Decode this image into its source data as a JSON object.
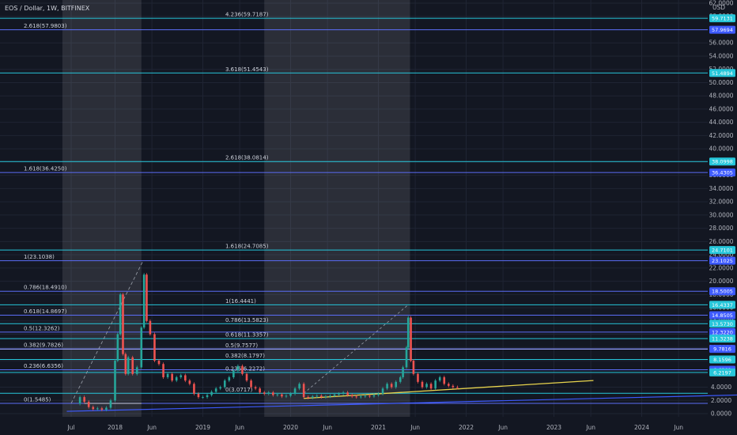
{
  "header": {
    "title": "EOS / Dollar, 1W, BITFINEX",
    "currency": "USD"
  },
  "chart_data": {
    "type": "line",
    "title": "EOS / Dollar, 1W, BITFINEX",
    "x_ticks": [
      "Jul",
      "2018",
      "Jun",
      "2019",
      "Jun",
      "2020",
      "Jun",
      "2021",
      "Jun",
      "2022",
      "Jun",
      "2023",
      "Jun",
      "2024",
      "Jun"
    ],
    "y_ticks": [
      "0.0000",
      "2.0000",
      "4.0000",
      "6.0000",
      "8.0000",
      "10.0000",
      "12.0000",
      "14.0000",
      "16.0000",
      "18.0000",
      "20.0000",
      "22.0000",
      "24.0000",
      "26.0000",
      "28.0000",
      "30.0000",
      "32.0000",
      "34.0000",
      "36.0000",
      "38.0000",
      "40.0000",
      "42.0000",
      "44.0000",
      "46.0000",
      "48.0000",
      "50.0000",
      "52.0000",
      "54.0000",
      "56.0000",
      "58.0000",
      "60.0000",
      "62.0000"
    ],
    "ylim": [
      0,
      62
    ],
    "fib_levels": [
      {
        "label": "4.236(59.7187)",
        "value": 59.7187,
        "color": "#26c6da",
        "anchor": "mid"
      },
      {
        "label": "2.618(57.9803)",
        "value": 57.9803,
        "color": "#5b6df6",
        "anchor": "left"
      },
      {
        "label": "3.618(51.4543)",
        "value": 51.4543,
        "color": "#26c6da",
        "anchor": "mid"
      },
      {
        "label": "2.618(38.0814)",
        "value": 38.0814,
        "color": "#26c6da",
        "anchor": "mid"
      },
      {
        "label": "1.618(36.4250)",
        "value": 36.425,
        "color": "#5b6df6",
        "anchor": "left"
      },
      {
        "label": "1.618(24.7085)",
        "value": 24.7085,
        "color": "#26c6da",
        "anchor": "mid"
      },
      {
        "label": "1(23.1038)",
        "value": 23.1038,
        "color": "#5b6df6",
        "anchor": "left"
      },
      {
        "label": "0.786(18.4910)",
        "value": 18.491,
        "color": "#5b6df6",
        "anchor": "left"
      },
      {
        "label": "1(16.4441)",
        "value": 16.4441,
        "color": "#26c6da",
        "anchor": "mid"
      },
      {
        "label": "0.618(14.8697)",
        "value": 14.8697,
        "color": "#5b6df6",
        "anchor": "left"
      },
      {
        "label": "0.786(13.5823)",
        "value": 13.5823,
        "color": "#26c6da",
        "anchor": "mid"
      },
      {
        "label": "0.5(12.3262)",
        "value": 12.3262,
        "color": "#5b6df6",
        "anchor": "left"
      },
      {
        "label": "0.618(11.3357)",
        "value": 11.3357,
        "color": "#26c6da",
        "anchor": "mid"
      },
      {
        "label": "0.382(9.7826)",
        "value": 9.7826,
        "color": "#5b6df6",
        "anchor": "left"
      },
      {
        "label": "0.5(9.7577)",
        "value": 9.7577,
        "color": "#9fa8ff",
        "anchor": "mid"
      },
      {
        "label": "0.382(8.1797)",
        "value": 8.1797,
        "color": "#26c6da",
        "anchor": "mid"
      },
      {
        "label": "0.236(6.6356)",
        "value": 6.6356,
        "color": "#5b6df6",
        "anchor": "left"
      },
      {
        "label": "0.236(6.2272)",
        "value": 6.2272,
        "color": "#26c6da",
        "anchor": "mid"
      },
      {
        "label": "0(1.5485)",
        "value": 1.5485,
        "color": "#5b6df6",
        "anchor": "left"
      },
      {
        "label": "0(3.0717)",
        "value": 3.0717,
        "color": "#26c6da",
        "anchor": "mid"
      }
    ],
    "price_badges": [
      {
        "text": "59.7131",
        "value": 59.7187,
        "color": "#26c6da"
      },
      {
        "text": "57.9694",
        "value": 57.9803,
        "color": "#3d5afe"
      },
      {
        "text": "51.4894",
        "value": 51.4543,
        "color": "#26c6da"
      },
      {
        "text": "38.0998",
        "value": 38.0814,
        "color": "#26c6da"
      },
      {
        "text": "36.4305",
        "value": 36.425,
        "color": "#3d5afe"
      },
      {
        "text": "24.7101",
        "value": 24.7085,
        "color": "#26c6da"
      },
      {
        "text": "23.1025",
        "value": 23.1038,
        "color": "#3d5afe"
      },
      {
        "text": "18.5005",
        "value": 18.491,
        "color": "#3d5afe"
      },
      {
        "text": "16.4337",
        "value": 16.4441,
        "color": "#26c6da"
      },
      {
        "text": "14.8505",
        "value": 14.8697,
        "color": "#3d5afe"
      },
      {
        "text": "13.5730",
        "value": 13.5823,
        "color": "#26c6da"
      },
      {
        "text": "12.3220",
        "value": 12.3262,
        "color": "#3d5afe"
      },
      {
        "text": "11.3238",
        "value": 11.3357,
        "color": "#26c6da"
      },
      {
        "text": "9.7816",
        "value": 9.7826,
        "color": "#3d5afe"
      },
      {
        "text": "8.1596",
        "value": 8.1797,
        "color": "#26c6da"
      },
      {
        "text": "6.6301",
        "value": 6.6356,
        "color": "#3d5afe"
      },
      {
        "text": "6.2197",
        "value": 6.2272,
        "color": "#26c6da"
      }
    ],
    "price_series": [
      [
        2017.55,
        1.5
      ],
      [
        2017.6,
        2.5
      ],
      [
        2017.65,
        1.8
      ],
      [
        2017.7,
        1.0
      ],
      [
        2017.75,
        0.7
      ],
      [
        2017.8,
        0.8
      ],
      [
        2017.85,
        0.6
      ],
      [
        2017.9,
        0.9
      ],
      [
        2017.95,
        2.0
      ],
      [
        2018.0,
        8.0
      ],
      [
        2018.03,
        12.0
      ],
      [
        2018.06,
        18.0
      ],
      [
        2018.09,
        9.0
      ],
      [
        2018.12,
        6.0
      ],
      [
        2018.15,
        8.5
      ],
      [
        2018.2,
        6.0
      ],
      [
        2018.25,
        7.0
      ],
      [
        2018.3,
        13.0
      ],
      [
        2018.33,
        21.0
      ],
      [
        2018.36,
        14.0
      ],
      [
        2018.4,
        12.0
      ],
      [
        2018.45,
        8.0
      ],
      [
        2018.5,
        7.5
      ],
      [
        2018.55,
        5.5
      ],
      [
        2018.6,
        6.0
      ],
      [
        2018.65,
        5.0
      ],
      [
        2018.7,
        5.5
      ],
      [
        2018.75,
        5.8
      ],
      [
        2018.8,
        5.0
      ],
      [
        2018.85,
        4.5
      ],
      [
        2018.9,
        3.0
      ],
      [
        2018.95,
        2.5
      ],
      [
        2019.0,
        2.5
      ],
      [
        2019.05,
        2.8
      ],
      [
        2019.1,
        3.3
      ],
      [
        2019.15,
        3.8
      ],
      [
        2019.2,
        4.0
      ],
      [
        2019.25,
        5.0
      ],
      [
        2019.3,
        5.5
      ],
      [
        2019.35,
        6.5
      ],
      [
        2019.4,
        7.2
      ],
      [
        2019.45,
        6.0
      ],
      [
        2019.5,
        5.0
      ],
      [
        2019.55,
        4.0
      ],
      [
        2019.6,
        3.8
      ],
      [
        2019.65,
        3.2
      ],
      [
        2019.7,
        3.0
      ],
      [
        2019.75,
        3.2
      ],
      [
        2019.8,
        2.8
      ],
      [
        2019.85,
        2.9
      ],
      [
        2019.9,
        2.6
      ],
      [
        2019.95,
        2.7
      ],
      [
        2020.0,
        3.0
      ],
      [
        2020.05,
        3.8
      ],
      [
        2020.1,
        4.5
      ],
      [
        2020.15,
        2.5
      ],
      [
        2020.2,
        2.4
      ],
      [
        2020.25,
        2.6
      ],
      [
        2020.3,
        2.7
      ],
      [
        2020.35,
        2.5
      ],
      [
        2020.4,
        2.6
      ],
      [
        2020.45,
        2.7
      ],
      [
        2020.5,
        2.9
      ],
      [
        2020.55,
        3.0
      ],
      [
        2020.6,
        3.2
      ],
      [
        2020.65,
        2.8
      ],
      [
        2020.7,
        2.6
      ],
      [
        2020.75,
        2.5
      ],
      [
        2020.8,
        2.6
      ],
      [
        2020.85,
        2.7
      ],
      [
        2020.9,
        2.6
      ],
      [
        2020.95,
        2.8
      ],
      [
        2021.0,
        3.0
      ],
      [
        2021.05,
        3.8
      ],
      [
        2021.1,
        4.5
      ],
      [
        2021.15,
        4.0
      ],
      [
        2021.2,
        4.8
      ],
      [
        2021.25,
        5.5
      ],
      [
        2021.28,
        7.0
      ],
      [
        2021.32,
        10.0
      ],
      [
        2021.34,
        14.5
      ],
      [
        2021.37,
        8.0
      ],
      [
        2021.4,
        6.0
      ],
      [
        2021.45,
        4.8
      ],
      [
        2021.5,
        4.0
      ],
      [
        2021.55,
        4.5
      ],
      [
        2021.6,
        3.8
      ],
      [
        2021.65,
        5.0
      ],
      [
        2021.7,
        5.5
      ],
      [
        2021.75,
        4.5
      ],
      [
        2021.8,
        4.2
      ],
      [
        2021.85,
        4.0
      ],
      [
        2021.9,
        3.9
      ]
    ]
  }
}
